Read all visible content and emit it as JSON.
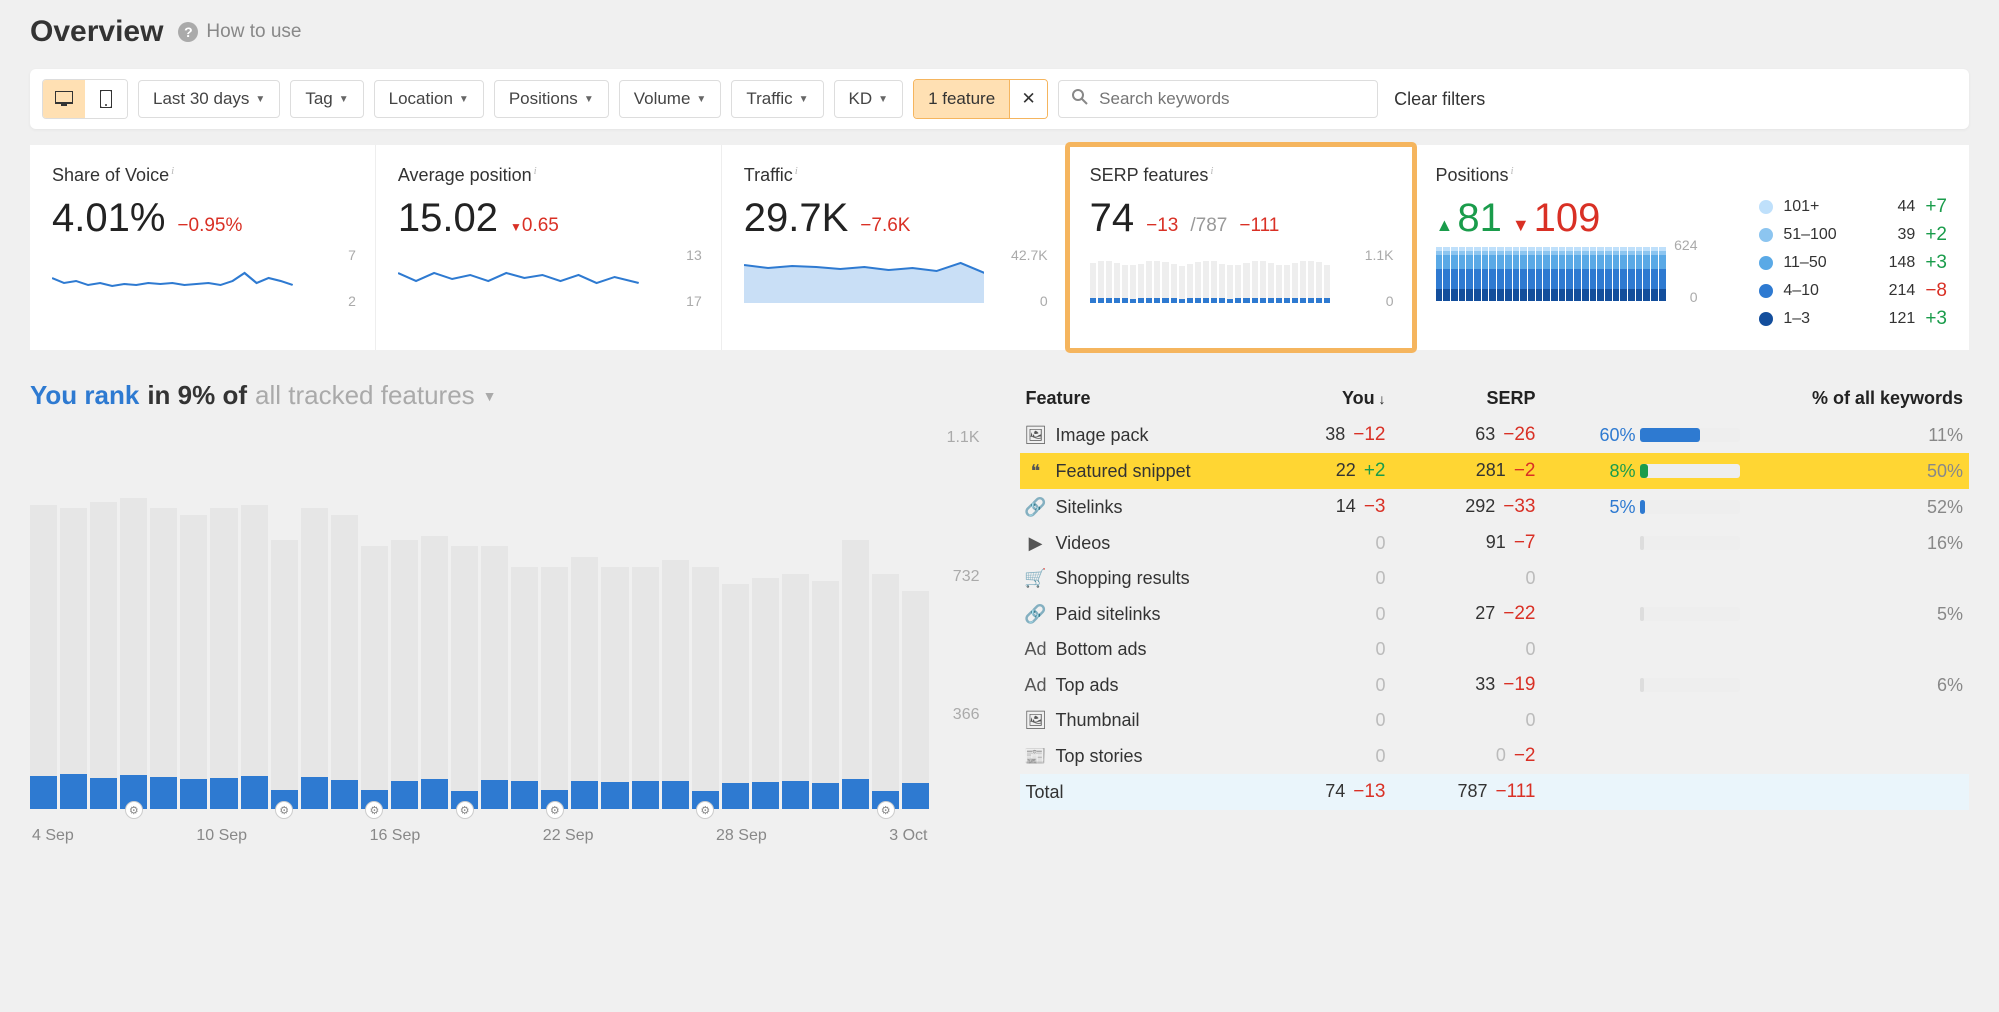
{
  "header": {
    "title": "Overview",
    "how_to_use": "How to use"
  },
  "filters": {
    "date_range": "Last 30 days",
    "tag": "Tag",
    "location": "Location",
    "positions": "Positions",
    "volume": "Volume",
    "traffic": "Traffic",
    "kd": "KD",
    "feature_filter": "1 feature",
    "search_placeholder": "Search keywords",
    "clear": "Clear filters"
  },
  "cards": {
    "sov": {
      "title": "Share of Voice",
      "value": "4.01%",
      "delta": "−0.95%",
      "ymax": "7",
      "ymin": "2"
    },
    "avg": {
      "title": "Average position",
      "value": "15.02",
      "delta": "0.65",
      "ymax": "13",
      "ymin": "17"
    },
    "traffic": {
      "title": "Traffic",
      "value": "29.7K",
      "delta": "−7.6K",
      "ymax": "42.7K",
      "ymin": "0"
    },
    "serp": {
      "title": "SERP features",
      "value": "74",
      "delta": "−13",
      "total": "/787",
      "total_delta": "−111",
      "ymax": "1.1K",
      "ymin": "0"
    },
    "positions": {
      "title": "Positions",
      "up": "81",
      "down": "109",
      "ymax": "624",
      "ymin": "0",
      "legend": [
        {
          "label": "101+",
          "val": "44",
          "delta": "+7",
          "sign": "pos",
          "color": "#bfe0fb"
        },
        {
          "label": "51–100",
          "val": "39",
          "delta": "+2",
          "sign": "pos",
          "color": "#8cc5f0"
        },
        {
          "label": "11–50",
          "val": "148",
          "delta": "+3",
          "sign": "pos",
          "color": "#5aa9e6"
        },
        {
          "label": "4–10",
          "val": "214",
          "delta": "−8",
          "sign": "neg",
          "color": "#2e7ad1"
        },
        {
          "label": "1–3",
          "val": "121",
          "delta": "+3",
          "sign": "pos",
          "color": "#134e9c"
        }
      ]
    }
  },
  "rank_heading": {
    "a": "You rank",
    "b": "in 9% of",
    "c": "all tracked features"
  },
  "big_chart_y": {
    "top": "1.1K",
    "mid": "732",
    "low": "366"
  },
  "big_chart_x": [
    "4 Sep",
    "10 Sep",
    "16 Sep",
    "22 Sep",
    "28 Sep",
    "3 Oct"
  ],
  "feat_head": {
    "feature": "Feature",
    "you": "You",
    "serp": "SERP",
    "pct_kw": "% of all keywords"
  },
  "features": [
    {
      "icon": "image-pack-icon",
      "name": "Image pack",
      "you": "38",
      "you_d": "−12",
      "serp": "63",
      "serp_d": "−26",
      "pct": "60%",
      "pct_cls": "pct-blue",
      "bar": 60,
      "bar_color": "#2e7ad1",
      "kw": "11%"
    },
    {
      "icon": "featured-snippet-icon",
      "name": "Featured snippet",
      "you": "22",
      "you_d": "+2",
      "you_sign": "pos",
      "serp": "281",
      "serp_d": "−2",
      "pct": "8%",
      "pct_cls": "pct-green",
      "bar": 8,
      "bar_color": "#1a9c4b",
      "kw": "50%",
      "hl": true
    },
    {
      "icon": "sitelinks-icon",
      "name": "Sitelinks",
      "you": "14",
      "you_d": "−3",
      "serp": "292",
      "serp_d": "−33",
      "pct": "5%",
      "pct_cls": "pct-blue",
      "bar": 5,
      "bar_color": "#2e7ad1",
      "kw": "52%"
    },
    {
      "icon": "videos-icon",
      "name": "Videos",
      "you": "0",
      "serp": "91",
      "serp_d": "−7",
      "bar": 0,
      "kw": "16%"
    },
    {
      "icon": "shopping-icon",
      "name": "Shopping results",
      "you": "0",
      "serp": "0"
    },
    {
      "icon": "paid-sitelinks-icon",
      "name": "Paid sitelinks",
      "you": "0",
      "serp": "27",
      "serp_d": "−22",
      "bar": 0,
      "kw": "5%"
    },
    {
      "icon": "bottom-ads-icon",
      "name": "Bottom ads",
      "you": "0",
      "serp": "0"
    },
    {
      "icon": "top-ads-icon",
      "name": "Top ads",
      "you": "0",
      "serp": "33",
      "serp_d": "−19",
      "bar": 0,
      "kw": "6%"
    },
    {
      "icon": "thumbnail-icon",
      "name": "Thumbnail",
      "you": "0",
      "serp": "0"
    },
    {
      "icon": "top-stories-icon",
      "name": "Top stories",
      "you": "0",
      "serp": "0",
      "serp_d": "−2"
    }
  ],
  "total_row": {
    "name": "Total",
    "you": "74",
    "you_d": "−13",
    "serp": "787",
    "serp_d": "−111"
  },
  "chart_data": {
    "big_chart": {
      "type": "bar",
      "title": "You rank in 9% of all tracked features",
      "ylim": [
        0,
        1100
      ],
      "series": [
        {
          "name": "total_bg",
          "values": [
            880,
            870,
            890,
            900,
            870,
            850,
            870,
            880,
            780,
            870,
            850,
            760,
            780,
            790,
            760,
            760,
            700,
            700,
            730,
            700,
            700,
            720,
            700,
            650,
            670,
            680,
            660,
            780,
            680,
            630
          ]
        },
        {
          "name": "you_fg",
          "values": [
            95,
            100,
            90,
            98,
            92,
            88,
            90,
            95,
            55,
            92,
            85,
            55,
            82,
            86,
            52,
            84,
            80,
            55,
            80,
            78,
            82,
            80,
            52,
            76,
            78,
            80,
            76,
            88,
            52,
            74
          ]
        }
      ],
      "gear_at": [
        3,
        8,
        11,
        14,
        17,
        22,
        28
      ]
    },
    "positions_dist": {
      "type": "stacked-bar",
      "ylim": [
        0,
        624
      ],
      "stacks": [
        "1-3",
        "4-10",
        "11-50",
        "51-100",
        "101+"
      ],
      "bars": 30
    }
  }
}
